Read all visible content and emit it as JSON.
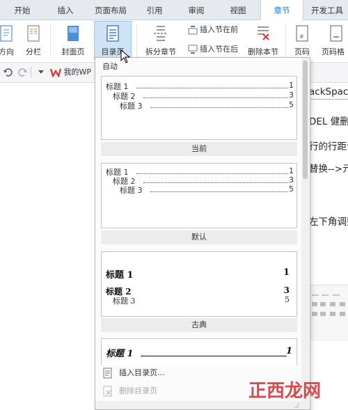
{
  "tabs": [
    "开始",
    "插入",
    "页面布局",
    "引用",
    "审阅",
    "视图",
    "章节",
    "开发工具"
  ],
  "active_tab": "章节",
  "ribbon": {
    "orientation_label": "方向",
    "columns_label": "分栏",
    "cover_label": "封面页",
    "toc_label": "目录页",
    "split_label": "拆分章节",
    "insert_before_label": "插入节在前",
    "insert_after_label": "插入节在后",
    "delete_section_label": "删除本节",
    "page_num_label": "页码",
    "page_num_format_label": "页码格"
  },
  "quickbar": {
    "doc_tab_label": "我的WP"
  },
  "dropdown": {
    "header": "自动",
    "styles": [
      {
        "caption": "当前",
        "lines": [
          {
            "text": "标题 1",
            "page": "1"
          },
          {
            "text": "标题 2",
            "page": "3"
          },
          {
            "text": "标题 3",
            "page": "5"
          }
        ]
      },
      {
        "caption": "默认",
        "lines": [
          {
            "text": "标题 1",
            "page": "1"
          },
          {
            "text": "标题 2",
            "page": "3"
          },
          {
            "text": "标题 3",
            "page": "5"
          }
        ]
      },
      {
        "caption": "古典",
        "lines": [
          {
            "text": "标题 1",
            "page": "1"
          },
          {
            "text": "标题 2",
            "page": "3"
          },
          {
            "text": "标题 3",
            "page": "5"
          }
        ]
      },
      {
        "caption": "",
        "lines": [
          {
            "text": "标题 1",
            "page": "1"
          }
        ]
      }
    ],
    "insert_toc_label": "插入目录页...",
    "delete_toc_label": "删除目录页"
  },
  "document": {
    "lines": [
      "ackSpac",
      "DEL 健删",
      "行的行距说",
      "替换-->亓",
      "左下角调整"
    ]
  },
  "watermark": {
    "text": "正西龙网"
  },
  "colors": {
    "accent": "#1f7fd1",
    "selected_bg": "#cfe3f7",
    "wps_red": "#d9322b",
    "watermark_red": "#d8353a"
  }
}
